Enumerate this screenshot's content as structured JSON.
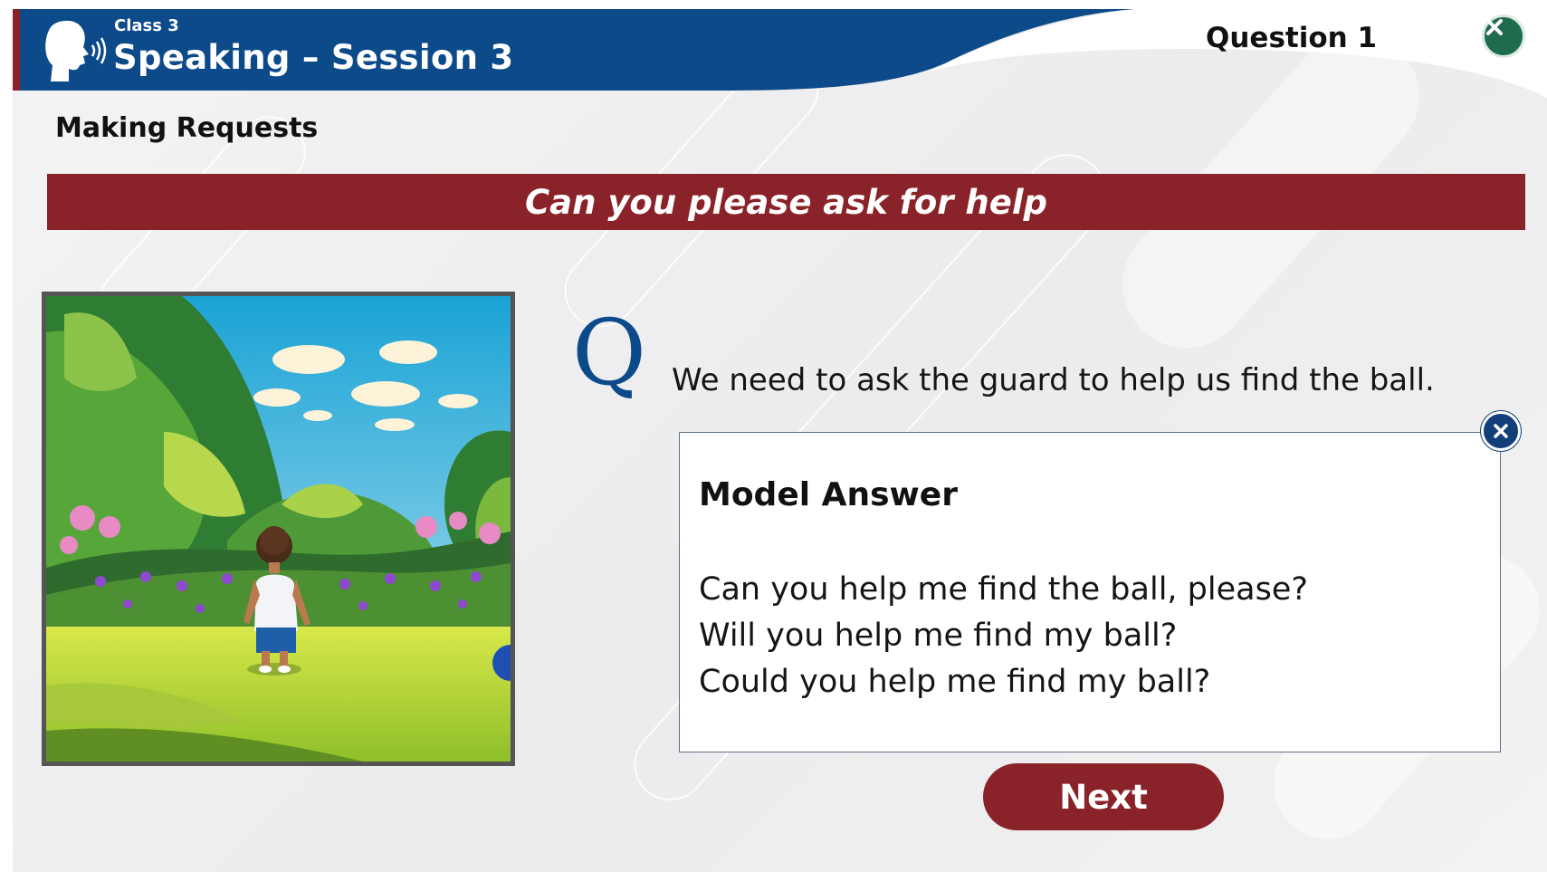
{
  "header": {
    "class_label": "Class 3",
    "session_title": "Speaking – Session 3",
    "question_label": "Question 1",
    "icon": "speaking-head-icon",
    "close_icon": "close-icon"
  },
  "topic": "Making Requests",
  "banner": "Can you please ask for help",
  "picture": {
    "icon": "boy-in-garden-illustration"
  },
  "question": {
    "marker": "Q",
    "text": "We need to ask the guard to help us find the ball."
  },
  "model_answer": {
    "title": "Model Answer",
    "lines": [
      "Can you help me find the ball, please?",
      "Will you help me find my ball?",
      "Could you help me find my ball?"
    ],
    "close_icon": "close-icon"
  },
  "next_label": "Next",
  "colors": {
    "header_blue": "#0d4a8a",
    "banner_maroon": "#8a2229",
    "close_green": "#1f6b4e",
    "answer_close_blue": "#123f7a"
  }
}
